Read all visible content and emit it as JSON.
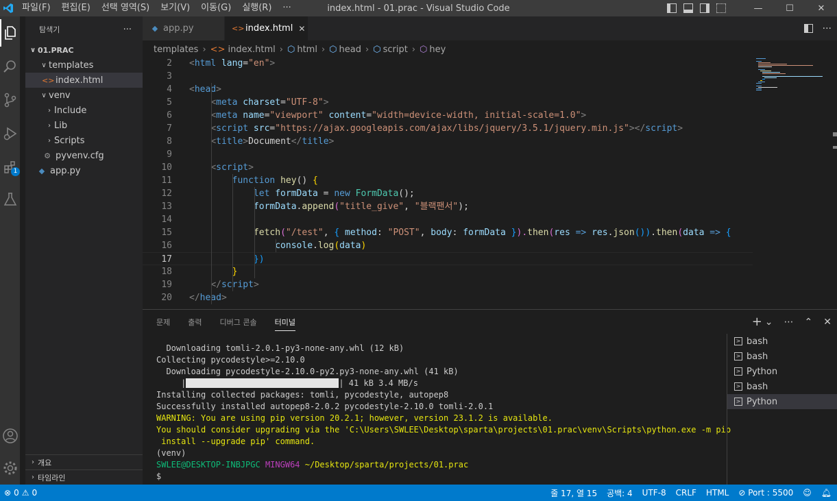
{
  "titlebar": {
    "menu": [
      "파일(F)",
      "편집(E)",
      "선택 영역(S)",
      "보기(V)",
      "이동(G)",
      "실행(R)",
      "···"
    ],
    "title": "index.html - 01.prac - Visual Studio Code",
    "minimize": "—",
    "maximize": "☐",
    "close": "✕"
  },
  "activity": {
    "extensions_badge": "1"
  },
  "sidebar": {
    "header": "탐색기",
    "more": "···",
    "root": "01.PRAC",
    "items": [
      "templates",
      "index.html",
      "venv",
      "Include",
      "Lib",
      "Scripts",
      "pyvenv.cfg",
      "app.py"
    ],
    "outline": "개요",
    "timeline": "타임라인"
  },
  "tabs": [
    {
      "label": "app.py",
      "icon": "python-icon"
    },
    {
      "label": "index.html",
      "icon": "html-icon",
      "close": "✕"
    }
  ],
  "breadcrumbs": [
    "templates",
    "index.html",
    "html",
    "head",
    "script",
    "hey"
  ],
  "editor": {
    "lines": [
      {
        "n": "2",
        "s": [
          [
            "<",
            "#808080"
          ],
          [
            "html",
            "#569cd6"
          ],
          [
            " lang",
            "#9cdcfe"
          ],
          [
            "=",
            "#d4d4d4"
          ],
          [
            "\"en\"",
            "#ce9178"
          ],
          [
            ">",
            "#808080"
          ]
        ]
      },
      {
        "n": "3",
        "s": []
      },
      {
        "n": "4",
        "s": [
          [
            "<",
            "#808080"
          ],
          [
            "head",
            "#569cd6"
          ],
          [
            ">",
            "#808080"
          ]
        ]
      },
      {
        "n": "5",
        "s": [
          [
            "    ",
            "#d4d4d4"
          ],
          [
            "<",
            "#808080"
          ],
          [
            "meta",
            "#569cd6"
          ],
          [
            " charset",
            "#9cdcfe"
          ],
          [
            "=",
            "#d4d4d4"
          ],
          [
            "\"UTF-8\"",
            "#ce9178"
          ],
          [
            ">",
            "#808080"
          ]
        ]
      },
      {
        "n": "6",
        "s": [
          [
            "    ",
            "#d4d4d4"
          ],
          [
            "<",
            "#808080"
          ],
          [
            "meta",
            "#569cd6"
          ],
          [
            " name",
            "#9cdcfe"
          ],
          [
            "=",
            "#d4d4d4"
          ],
          [
            "\"viewport\"",
            "#ce9178"
          ],
          [
            " content",
            "#9cdcfe"
          ],
          [
            "=",
            "#d4d4d4"
          ],
          [
            "\"width=device-width, initial-scale=1.0\"",
            "#ce9178"
          ],
          [
            ">",
            "#808080"
          ]
        ]
      },
      {
        "n": "7",
        "s": [
          [
            "    ",
            "#d4d4d4"
          ],
          [
            "<",
            "#808080"
          ],
          [
            "script",
            "#569cd6"
          ],
          [
            " src",
            "#9cdcfe"
          ],
          [
            "=",
            "#d4d4d4"
          ],
          [
            "\"https://ajax.googleapis.com/ajax/libs/jquery/3.5.1/jquery.min.js\"",
            "#ce9178"
          ],
          [
            "></",
            "#808080"
          ],
          [
            "script",
            "#569cd6"
          ],
          [
            ">",
            "#808080"
          ]
        ]
      },
      {
        "n": "8",
        "s": [
          [
            "    ",
            "#d4d4d4"
          ],
          [
            "<",
            "#808080"
          ],
          [
            "title",
            "#569cd6"
          ],
          [
            ">",
            "#808080"
          ],
          [
            "Document",
            "#d4d4d4"
          ],
          [
            "</",
            "#808080"
          ],
          [
            "title",
            "#569cd6"
          ],
          [
            ">",
            "#808080"
          ]
        ]
      },
      {
        "n": "9",
        "s": []
      },
      {
        "n": "10",
        "s": [
          [
            "    ",
            "#d4d4d4"
          ],
          [
            "<",
            "#808080"
          ],
          [
            "script",
            "#569cd6"
          ],
          [
            ">",
            "#808080"
          ]
        ]
      },
      {
        "n": "11",
        "s": [
          [
            "        ",
            "#d4d4d4"
          ],
          [
            "function",
            "#569cd6"
          ],
          [
            " ",
            "#d4d4d4"
          ],
          [
            "hey",
            "#dcdcaa"
          ],
          [
            "() ",
            "#d4d4d4"
          ],
          [
            "{",
            "#ffd700"
          ]
        ]
      },
      {
        "n": "12",
        "s": [
          [
            "            ",
            "#d4d4d4"
          ],
          [
            "let",
            "#569cd6"
          ],
          [
            " formData",
            "#9cdcfe"
          ],
          [
            " = ",
            "#d4d4d4"
          ],
          [
            "new",
            "#569cd6"
          ],
          [
            " ",
            "#d4d4d4"
          ],
          [
            "FormData",
            "#4ec9b0"
          ],
          [
            "();",
            "#d4d4d4"
          ]
        ]
      },
      {
        "n": "13",
        "s": [
          [
            "            ",
            "#d4d4d4"
          ],
          [
            "formData",
            "#9cdcfe"
          ],
          [
            ".",
            "#d4d4d4"
          ],
          [
            "append",
            "#dcdcaa"
          ],
          [
            "(",
            "#da70d6"
          ],
          [
            "\"title_give\"",
            "#ce9178"
          ],
          [
            ", ",
            "#d4d4d4"
          ],
          [
            "\"블랙팬서\"",
            "#ce9178"
          ],
          [
            ");",
            "#d4d4d4"
          ]
        ]
      },
      {
        "n": "14",
        "s": []
      },
      {
        "n": "15",
        "s": [
          [
            "            ",
            "#d4d4d4"
          ],
          [
            "fetch",
            "#dcdcaa"
          ],
          [
            "(",
            "#da70d6"
          ],
          [
            "\"/test\"",
            "#ce9178"
          ],
          [
            ", ",
            "#d4d4d4"
          ],
          [
            "{",
            "#179fff"
          ],
          [
            " method",
            "#9cdcfe"
          ],
          [
            ": ",
            "#d4d4d4"
          ],
          [
            "\"POST\"",
            "#ce9178"
          ],
          [
            ", ",
            "#d4d4d4"
          ],
          [
            "body",
            "#9cdcfe"
          ],
          [
            ": ",
            "#d4d4d4"
          ],
          [
            "formData",
            "#9cdcfe"
          ],
          [
            " }",
            "#179fff"
          ],
          [
            ").",
            "#da70d6"
          ],
          [
            "then",
            "#dcdcaa"
          ],
          [
            "(",
            "#da70d6"
          ],
          [
            "res",
            "#9cdcfe"
          ],
          [
            " => ",
            "#569cd6"
          ],
          [
            "res",
            "#9cdcfe"
          ],
          [
            ".",
            "#d4d4d4"
          ],
          [
            "json",
            "#dcdcaa"
          ],
          [
            "())",
            "#179fff"
          ],
          [
            ".",
            "#d4d4d4"
          ],
          [
            "then",
            "#dcdcaa"
          ],
          [
            "(",
            "#da70d6"
          ],
          [
            "data",
            "#9cdcfe"
          ],
          [
            " => ",
            "#569cd6"
          ],
          [
            "{",
            "#179fff"
          ]
        ]
      },
      {
        "n": "16",
        "s": [
          [
            "                ",
            "#d4d4d4"
          ],
          [
            "console",
            "#9cdcfe"
          ],
          [
            ".",
            "#d4d4d4"
          ],
          [
            "log",
            "#dcdcaa"
          ],
          [
            "(",
            "#ffd700"
          ],
          [
            "data",
            "#9cdcfe"
          ],
          [
            ")",
            "#ffd700"
          ]
        ]
      },
      {
        "n": "17",
        "s": [
          [
            "            ",
            "#d4d4d4"
          ],
          [
            "})",
            "#179fff"
          ]
        ]
      },
      {
        "n": "18",
        "s": [
          [
            "        ",
            "#d4d4d4"
          ],
          [
            "}",
            "#ffd700"
          ]
        ]
      },
      {
        "n": "19",
        "s": [
          [
            "    ",
            "#d4d4d4"
          ],
          [
            "</",
            "#808080"
          ],
          [
            "script",
            "#569cd6"
          ],
          [
            ">",
            "#808080"
          ]
        ]
      },
      {
        "n": "20",
        "s": [
          [
            "</",
            "#808080"
          ],
          [
            "head",
            "#569cd6"
          ],
          [
            ">",
            "#808080"
          ]
        ]
      }
    ],
    "current_line": "17"
  },
  "panel": {
    "tabs": [
      "문제",
      "출력",
      "디버그 콘솔",
      "터미널"
    ],
    "active_tab": "터미널",
    "actions": [
      "+",
      "⌄",
      "⋯",
      "⌃",
      "✕"
    ],
    "terminal": [
      {
        "t": "  Downloading tomli-2.0.1-py3-none-any.whl (12 kB)",
        "c": "#cccccc"
      },
      {
        "t": "Collecting pycodestyle>=2.10.0",
        "c": "#cccccc"
      },
      {
        "t": "  Downloading pycodestyle-2.10.0-py2.py3-none-any.whl (41 kB)",
        "c": "#cccccc"
      },
      {
        "t": "     |",
        "c": "#cccccc",
        "bar": true,
        "after": "| 41 kB 3.4 MB/s"
      },
      {
        "t": "Installing collected packages: tomli, pycodestyle, autopep8",
        "c": "#cccccc"
      },
      {
        "t": "Successfully installed autopep8-2.0.2 pycodestyle-2.10.0 tomli-2.0.1",
        "c": "#cccccc"
      },
      {
        "t": "WARNING: You are using pip version 20.2.1; however, version 23.1.2 is available.",
        "c": "#e5e510"
      },
      {
        "t": "You should consider upgrading via the 'C:\\Users\\SWLEE\\Desktop\\sparta\\projects\\01.prac\\venv\\Scripts\\python.exe -m pip",
        "c": "#e5e510"
      },
      {
        "t": " install --upgrade pip' command.",
        "c": "#e5e510"
      },
      {
        "t": "(venv)",
        "c": "#cccccc"
      },
      {
        "prompt": true,
        "user": "SWLEE@DESKTOP-INBJPGC",
        "shell": "MINGW64",
        "path": "~/Desktop/sparta/projects/01.prac"
      },
      {
        "t": "$",
        "c": "#cccccc"
      }
    ],
    "terminals": [
      "bash",
      "bash",
      "Python",
      "bash",
      "Python"
    ],
    "selected_terminal": 4
  },
  "statusbar": {
    "errors": "0",
    "warnings": "0",
    "position": "줄 17, 열 15",
    "spaces": "공백: 4",
    "encoding": "UTF-8",
    "eol": "CRLF",
    "language": "HTML",
    "port": "Port : 5500"
  },
  "colors": {
    "accent": "#007acc",
    "prompt_user": "#0dbc79",
    "prompt_shell": "#bc3fbc",
    "prompt_path": "#e5e510"
  }
}
